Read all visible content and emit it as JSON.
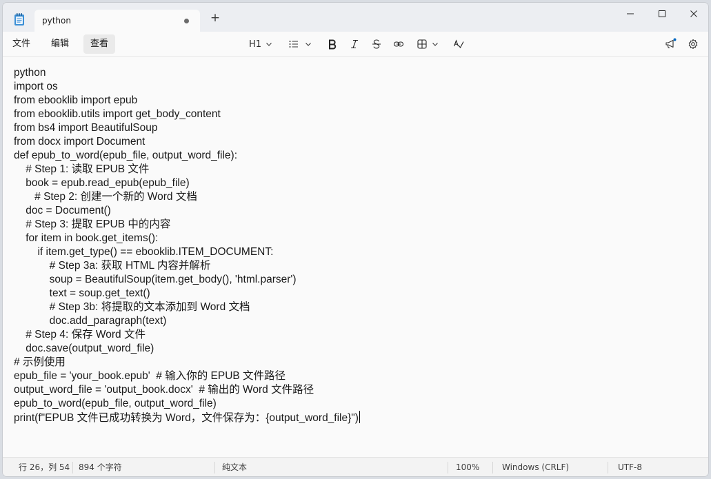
{
  "titlebar": {
    "tab_title": "python",
    "new_tab_label": "+"
  },
  "menu": {
    "items": [
      "文件",
      "编辑",
      "查看"
    ]
  },
  "toolbar": {
    "heading_label": "H1"
  },
  "editor": {
    "lines": [
      "python",
      "import os",
      "from ebooklib import epub",
      "from ebooklib.utils import get_body_content",
      "from bs4 import BeautifulSoup",
      "from docx import Document",
      "def epub_to_word(epub_file, output_word_file):",
      "    # Step 1: 读取 EPUB 文件",
      "    book = epub.read_epub(epub_file)",
      "       # Step 2: 创建一个新的 Word 文档",
      "    doc = Document()",
      "    # Step 3: 提取 EPUB 中的内容",
      "    for item in book.get_items():",
      "        if item.get_type() == ebooklib.ITEM_DOCUMENT:",
      "            # Step 3a: 获取 HTML 内容并解析",
      "            soup = BeautifulSoup(item.get_body(), 'html.parser')",
      "            text = soup.get_text()",
      "            # Step 3b: 将提取的文本添加到 Word 文档",
      "            doc.add_paragraph(text)",
      "    # Step 4: 保存 Word 文件",
      "    doc.save(output_word_file)",
      "# 示例使用",
      "epub_file = 'your_book.epub'  # 输入你的 EPUB 文件路径",
      "output_word_file = 'output_book.docx'  # 输出的 Word 文件路径",
      "epub_to_word(epub_file, output_word_file)",
      "print(f\"EPUB 文件已成功转换为 Word，文件保存为：{output_word_file}\")"
    ]
  },
  "status": {
    "position": "行 26，列 54",
    "char_count": "894 个字符",
    "format": "纯文本",
    "zoom": "100%",
    "line_ending": "Windows (CRLF)",
    "encoding": "UTF-8"
  },
  "icons": {
    "app": "notepad-icon",
    "tab_modified": "unsaved-dot-icon",
    "minimize": "minimize-icon",
    "maximize": "maximize-icon",
    "close": "close-icon",
    "list": "bullet-list-icon",
    "bold": "bold-icon",
    "italic": "italic-icon",
    "strike": "strikethrough-icon",
    "link": "link-icon",
    "table": "table-icon",
    "spell": "spellcheck-icon",
    "copilot": "megaphone-icon",
    "settings": "gear-icon"
  },
  "colors": {
    "notification_dot": "#0067c0",
    "background": "#fafafa"
  }
}
